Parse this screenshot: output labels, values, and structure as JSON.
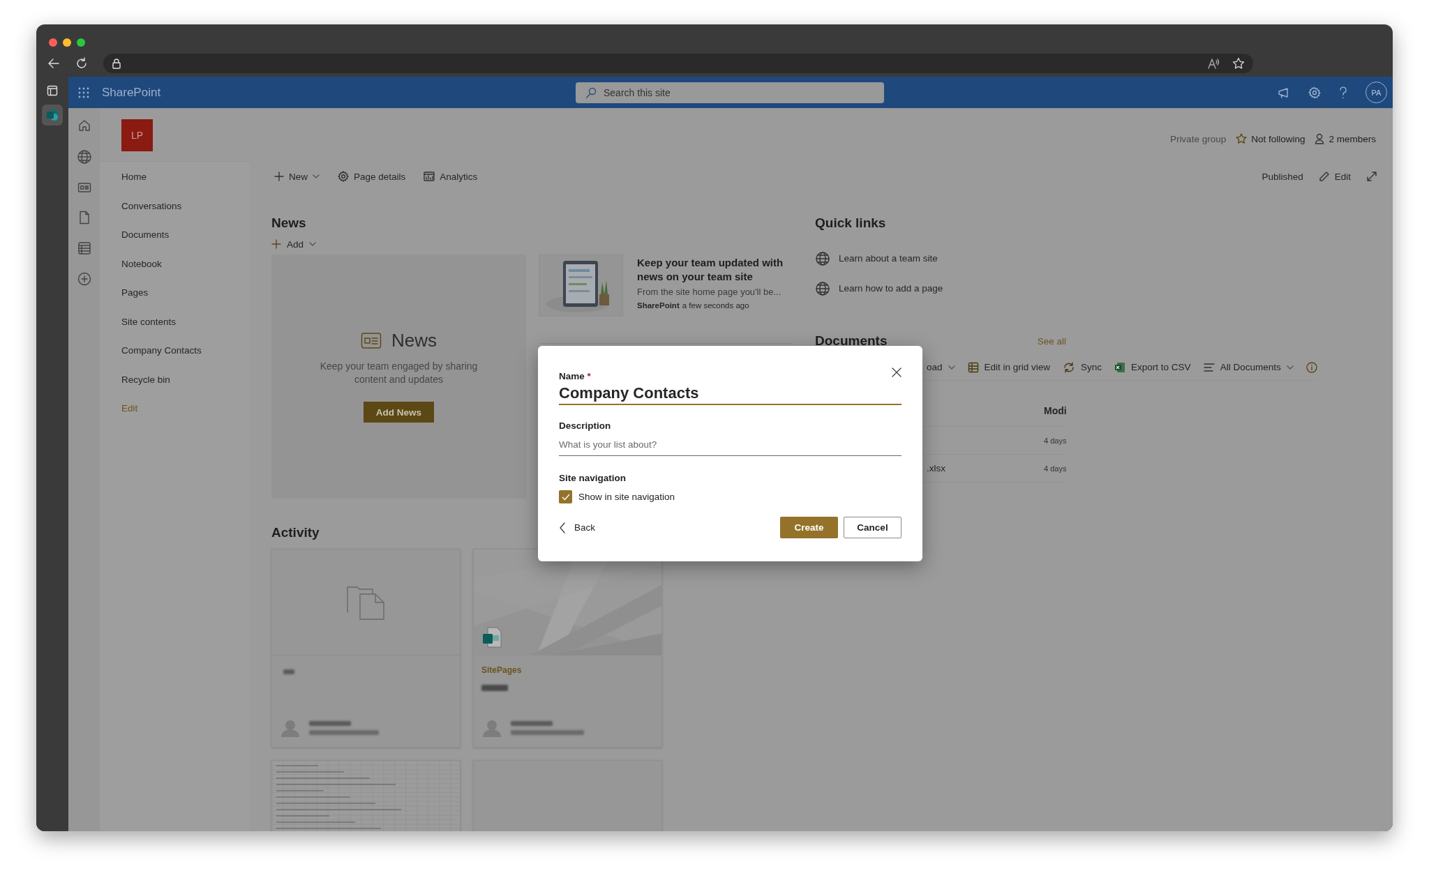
{
  "app_bar": {
    "title": "SharePoint",
    "search": {
      "placeholder": "Search this site"
    },
    "avatar": "PA"
  },
  "site": {
    "logo": "LP",
    "group_type": "Private group",
    "follow": {
      "label": "Not following",
      "following": false
    },
    "members": "2 members"
  },
  "nav": [
    {
      "label": "Home",
      "kind": "item"
    },
    {
      "label": "Conversations",
      "kind": "item"
    },
    {
      "label": "Documents",
      "kind": "item"
    },
    {
      "label": "Notebook",
      "kind": "item"
    },
    {
      "label": "Pages",
      "kind": "item"
    },
    {
      "label": "Site contents",
      "kind": "item"
    },
    {
      "label": "Company Contacts",
      "kind": "item"
    },
    {
      "label": "Recycle bin",
      "kind": "item"
    },
    {
      "label": "Edit",
      "kind": "link"
    }
  ],
  "command_bar": {
    "items": [
      {
        "label": "New",
        "kind": "new",
        "dropdown": true
      },
      {
        "label": "Page details",
        "kind": "details",
        "dropdown": false
      },
      {
        "label": "Analytics",
        "kind": "analytics",
        "dropdown": false
      }
    ],
    "status": "Published",
    "edit": "Edit"
  },
  "news": {
    "title": "News",
    "add": "Add",
    "placeholder": {
      "title": "News",
      "text": "Keep your team engaged by sharing content and updates",
      "button": "Add News"
    },
    "item": {
      "title": "Keep your team updated with news on your team site",
      "summary": "From the site home page you'll be...",
      "author": "SharePoint",
      "time": "a few seconds ago"
    }
  },
  "quick_links": {
    "title": "Quick links",
    "links": [
      "Learn about a team site",
      "Learn how to add a page"
    ]
  },
  "documents": {
    "title": "Documents",
    "see_all": "See all",
    "toolbar": [
      {
        "label": "oad",
        "kind": "upload",
        "dropdown": true
      },
      {
        "label": "Edit in grid view",
        "kind": "grid",
        "dropdown": false
      },
      {
        "label": "Sync",
        "kind": "sync",
        "dropdown": false
      },
      {
        "label": "Export to CSV",
        "kind": "excel",
        "dropdown": false
      },
      {
        "label": "All Documents",
        "kind": "view",
        "dropdown": true
      },
      {
        "kind": "info"
      }
    ],
    "column": "Modi",
    "rows": [
      {
        "modified": "4 days"
      },
      {
        "name": ".xlsx",
        "modified": "4 days"
      }
    ]
  },
  "activity": {
    "title": "Activity",
    "cards": [
      {
        "kind": "folder"
      },
      {
        "kind": "page",
        "location": "SitePages"
      },
      {
        "kind": "spreadsheet"
      },
      {
        "kind": "blank"
      }
    ]
  },
  "dialog": {
    "name_label": "Name",
    "required_mark": "*",
    "name_value": "Company Contacts",
    "description_label": "Description",
    "description_placeholder": "What is your list about?",
    "section": "Site navigation",
    "checkbox": {
      "label": "Show in site navigation",
      "checked": true
    },
    "back": "Back",
    "buttons": [
      {
        "label": "Create",
        "kind": "primary"
      },
      {
        "label": "Cancel",
        "kind": "secondary"
      }
    ]
  }
}
